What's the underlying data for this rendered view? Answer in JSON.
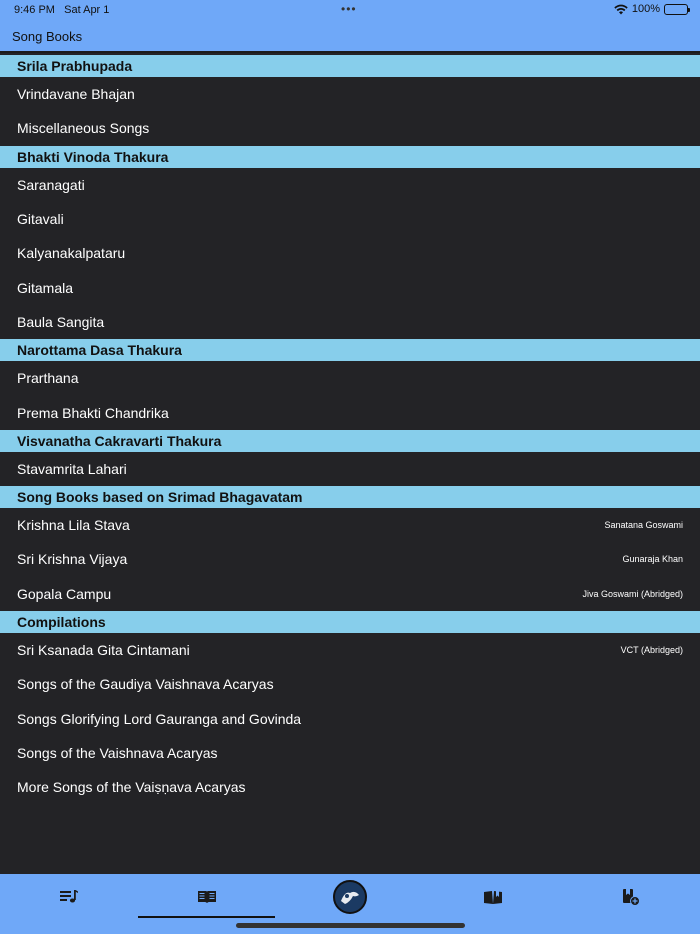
{
  "status_bar": {
    "time": "9:46 PM",
    "date": "Sat Apr 1",
    "dots": "•••",
    "battery": "100%"
  },
  "nav": {
    "title": "Song Books"
  },
  "sections": [
    {
      "header": "Srila Prabhupada",
      "rows": [
        {
          "title": "Vrindavane Bhajan",
          "subtitle": ""
        },
        {
          "title": "Miscellaneous Songs",
          "subtitle": ""
        }
      ]
    },
    {
      "header": "Bhakti Vinoda Thakura",
      "rows": [
        {
          "title": "Saranagati",
          "subtitle": ""
        },
        {
          "title": "Gitavali",
          "subtitle": ""
        },
        {
          "title": "Kalyanakalpataru",
          "subtitle": ""
        },
        {
          "title": "Gitamala",
          "subtitle": ""
        },
        {
          "title": "Baula Sangita",
          "subtitle": ""
        }
      ]
    },
    {
      "header": "Narottama Dasa Thakura",
      "rows": [
        {
          "title": "Prarthana",
          "subtitle": ""
        },
        {
          "title": "Prema Bhakti Chandrika",
          "subtitle": ""
        }
      ]
    },
    {
      "header": "Visvanatha Cakravarti Thakura",
      "rows": [
        {
          "title": "Stavamrita Lahari",
          "subtitle": ""
        }
      ]
    },
    {
      "header": "Song Books based on Srimad Bhagavatam",
      "rows": [
        {
          "title": "Krishna Lila Stava",
          "subtitle": "Sanatana Goswami"
        },
        {
          "title": "Sri Krishna Vijaya",
          "subtitle": "Gunaraja Khan"
        },
        {
          "title": "Gopala Campu",
          "subtitle": "Jiva Goswami (Abridged)"
        }
      ]
    },
    {
      "header": "Compilations",
      "rows": [
        {
          "title": "Sri Ksanada Gita Cintamani",
          "subtitle": "VCT (Abridged)"
        },
        {
          "title": "Songs of the Gaudiya Vaishnava Acaryas",
          "subtitle": ""
        },
        {
          "title": "Songs Glorifying Lord Gauranga and Govinda",
          "subtitle": ""
        },
        {
          "title": "Songs of the Vaishnava Acaryas",
          "subtitle": ""
        },
        {
          "title": "More Songs of the Vaiṣṇava Acaryas",
          "subtitle": ""
        }
      ]
    }
  ],
  "tabs": [
    {
      "icon": "song-list-icon",
      "selected": false
    },
    {
      "icon": "open-book-icon",
      "selected": true
    },
    {
      "icon": "logo-icon",
      "selected": false
    },
    {
      "icon": "reading-book-icon",
      "selected": false
    },
    {
      "icon": "add-bookmark-icon",
      "selected": false
    }
  ],
  "colors": {
    "bar": "#6fa8f8",
    "section_header": "#87ceeb",
    "list_bg": "#232326"
  }
}
